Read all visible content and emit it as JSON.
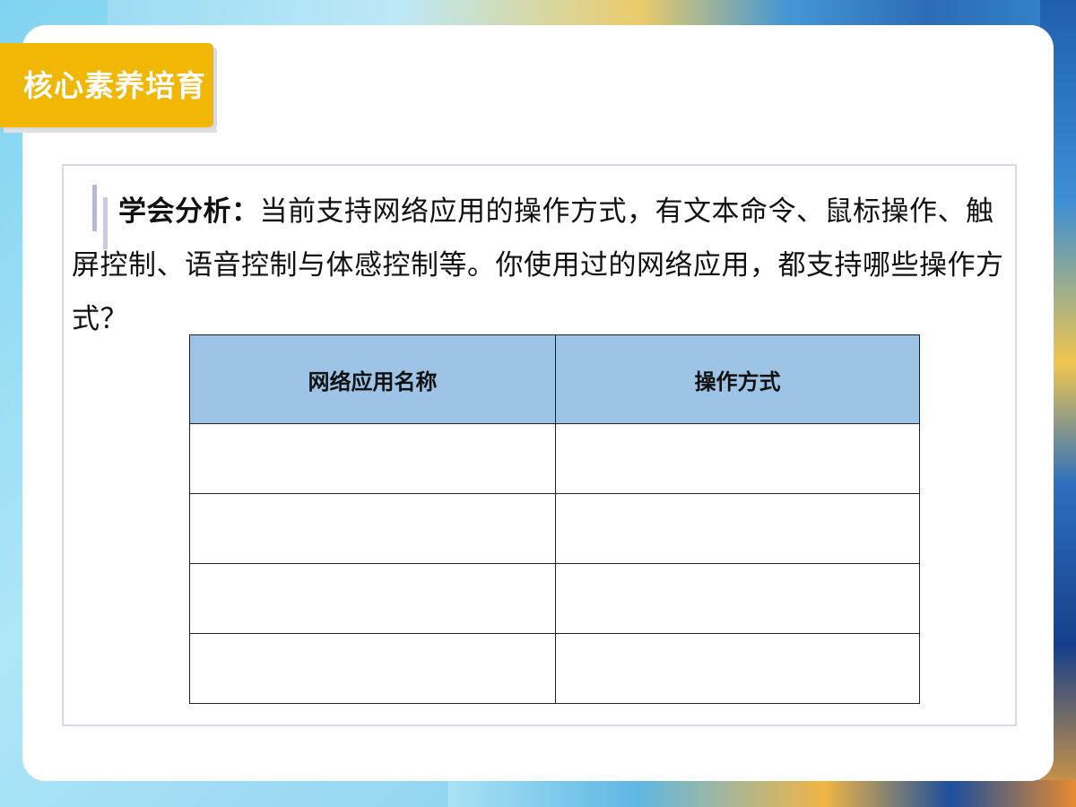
{
  "section_title": "核心素养培育",
  "paragraph": {
    "lead": "学会分析：",
    "text": "当前支持网络应用的操作方式，有文本命令、鼠标操作、触屏控制、语音控制与体感控制等。你使用过的网络应用，都支持哪些操作方式？"
  },
  "table": {
    "headers": [
      "网络应用名称",
      "操作方式"
    ],
    "rows": [
      [
        "",
        ""
      ],
      [
        "",
        ""
      ],
      [
        "",
        ""
      ],
      [
        "",
        ""
      ]
    ]
  }
}
